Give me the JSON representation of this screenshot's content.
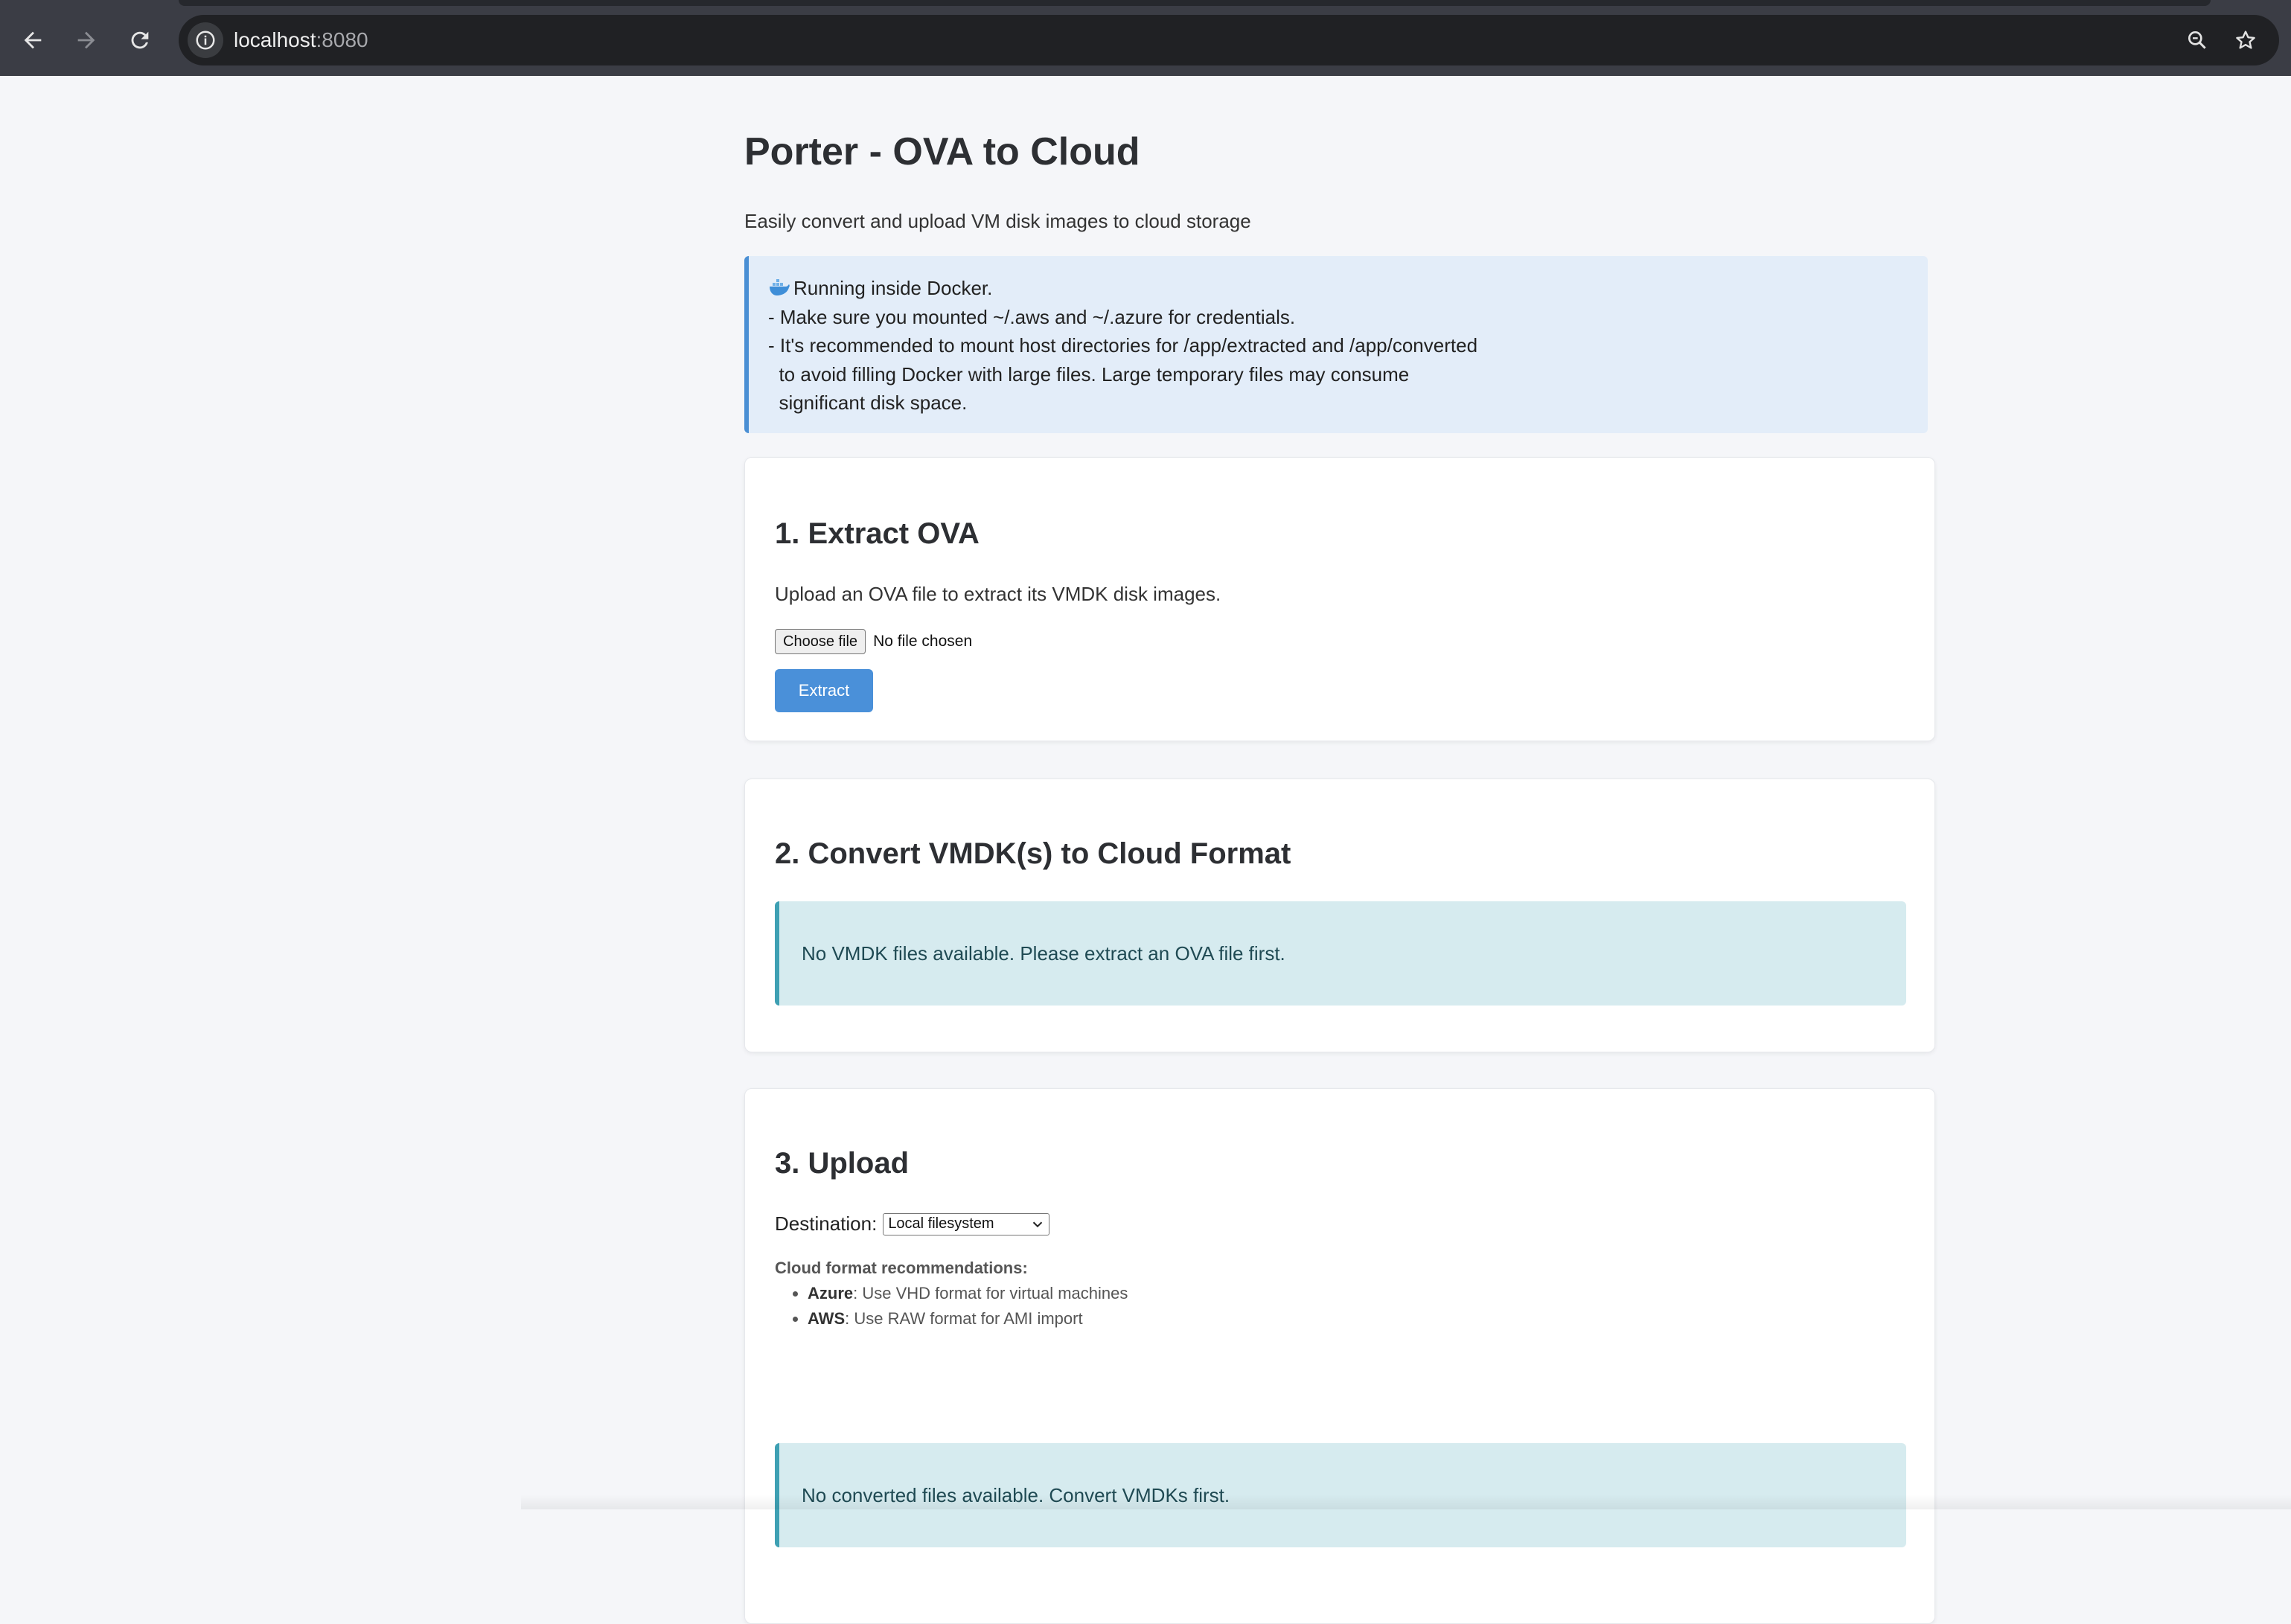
{
  "browser": {
    "url_host": "localhost",
    "url_port": ":8080"
  },
  "page": {
    "title": "Porter - OVA to Cloud",
    "subtitle": "Easily convert and upload VM disk images to cloud storage",
    "docker_note": {
      "line1": "Running inside Docker.",
      "line2": "- Make sure you mounted ~/.aws and ~/.azure for credentials.",
      "line3": "- It's recommended to mount host directories for /app/extracted and /app/converted",
      "line4": "  to avoid filling Docker with large files. Large temporary files may consume",
      "line5": "  significant disk space."
    }
  },
  "extract": {
    "heading": "1. Extract OVA",
    "description": "Upload an OVA file to extract its VMDK disk images.",
    "choose_file_label": "Choose file",
    "file_status": "No file chosen",
    "extract_button": "Extract"
  },
  "convert": {
    "heading": "2. Convert VMDK(s) to Cloud Format",
    "empty_message": "No VMDK files available. Please extract an OVA file first."
  },
  "upload": {
    "heading": "3. Upload",
    "destination_label": "Destination:",
    "destination_selected": "Local filesystem",
    "recommendations_title": "Cloud format recommendations:",
    "recommendations": [
      {
        "provider": "Azure",
        "text": ": Use VHD format for virtual machines"
      },
      {
        "provider": "AWS",
        "text": ": Use RAW format for AMI import"
      }
    ],
    "empty_message": "No converted files available. Convert VMDKs first."
  }
}
